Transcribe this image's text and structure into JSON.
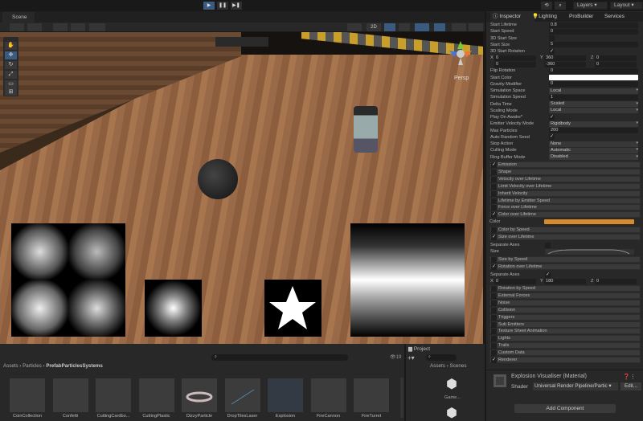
{
  "toolbar": {
    "layers": "Layers",
    "layout": "Layout",
    "play": "▶",
    "pause": "❚❚",
    "step": "▶❚"
  },
  "scene": {
    "tab": "Scene",
    "mode_2d": "2D",
    "persp": "Persp"
  },
  "inspector": {
    "tabs": [
      "Inspector",
      "Lighting",
      "ProBuilder",
      "Services"
    ],
    "rows": [
      {
        "label": "Start Lifetime",
        "value": "0.8",
        "type": "field"
      },
      {
        "label": "Start Speed",
        "value": "0",
        "type": "field"
      },
      {
        "label": "3D Start Size",
        "value": "",
        "type": "check"
      },
      {
        "label": "Start Size",
        "value": "5",
        "type": "field"
      },
      {
        "label": "3D Start Rotation",
        "value": "✓",
        "type": "check"
      },
      {
        "label": "X",
        "value": "0",
        "type": "xyz",
        "y": "360",
        "z": "0",
        "y2": "-360",
        "x2": "0",
        "z2": "0"
      },
      {
        "label": "Flip Rotation",
        "value": "0",
        "type": "field"
      },
      {
        "label": "Start Color",
        "value": "",
        "type": "color"
      },
      {
        "label": "Gravity Modifier",
        "value": "0",
        "type": "field"
      },
      {
        "label": "Simulation Space",
        "value": "Local",
        "type": "drop"
      },
      {
        "label": "Simulation Speed",
        "value": "1",
        "type": "field"
      },
      {
        "label": "Delta Time",
        "value": "Scaled",
        "type": "drop"
      },
      {
        "label": "Scaling Mode",
        "value": "Local",
        "type": "drop"
      },
      {
        "label": "Play On Awake*",
        "value": "✓",
        "type": "check"
      },
      {
        "label": "Emitter Velocity Mode",
        "value": "Rigidbody",
        "type": "drop"
      },
      {
        "label": "Max Particles",
        "value": "200",
        "type": "field"
      },
      {
        "label": "Auto Random Seed",
        "value": "✓",
        "type": "check"
      },
      {
        "label": "Stop Action",
        "value": "None",
        "type": "drop"
      },
      {
        "label": "Culling Mode",
        "value": "Automatic",
        "type": "drop"
      },
      {
        "label": "Ring Buffer Mode",
        "value": "Disabled",
        "type": "drop"
      }
    ],
    "modules_a": [
      {
        "label": "Emission",
        "on": true
      },
      {
        "label": "Shape",
        "on": false
      },
      {
        "label": "Velocity over Lifetime",
        "on": false
      },
      {
        "label": "Limit Velocity over Lifetime",
        "on": false
      },
      {
        "label": "Inherit Velocity",
        "on": false
      },
      {
        "label": "Lifetime by Emitter Speed",
        "on": false
      },
      {
        "label": "Force over Lifetime",
        "on": false
      },
      {
        "label": "Color over Lifetime",
        "on": true
      }
    ],
    "color_label": "Color",
    "color_gradient": "#d98a2b",
    "color_by_speed": "Color by Speed",
    "size_over_lifetime": "Size over Lifetime",
    "separate_axes": "Separate Axes",
    "size_label": "Size",
    "size_by_speed": "Size by Speed",
    "rotation_over_lifetime": "Rotation over Lifetime",
    "rot": {
      "x": "0",
      "y": "180",
      "z": "0"
    },
    "modules_b": [
      {
        "label": "Rotation by Speed",
        "on": false
      },
      {
        "label": "External Forces",
        "on": false
      },
      {
        "label": "Noise",
        "on": false
      },
      {
        "label": "Collision",
        "on": false
      },
      {
        "label": "Triggers",
        "on": false
      },
      {
        "label": "Sub Emitters",
        "on": false
      },
      {
        "label": "Texture Sheet Animation",
        "on": false
      },
      {
        "label": "Lights",
        "on": false
      },
      {
        "label": "Trails",
        "on": false
      },
      {
        "label": "Custom Data",
        "on": false
      },
      {
        "label": "Renderer",
        "on": true
      }
    ],
    "material": {
      "name": "Explosion Visualiser (Material)",
      "shader_label": "Shader",
      "shader": "Universal Render Pipeline/Partic",
      "edit": "Edit..."
    },
    "add_component": "Add Component"
  },
  "project": {
    "breadcrumb": [
      "Assets",
      "Particles",
      "PrefabParticlesSystems"
    ],
    "count": "19",
    "assets": [
      "CoinCollection",
      "Confetti",
      "CuttingCardbo...",
      "CuttingPlastic",
      "DizzyParticle",
      "DropTilesLaser",
      "Explosion",
      "FireCannon",
      "FireTurret"
    ],
    "tab2": "Project",
    "breadcrumb2": [
      "Assets",
      "Scenes"
    ],
    "scene_asset": "Game..."
  }
}
